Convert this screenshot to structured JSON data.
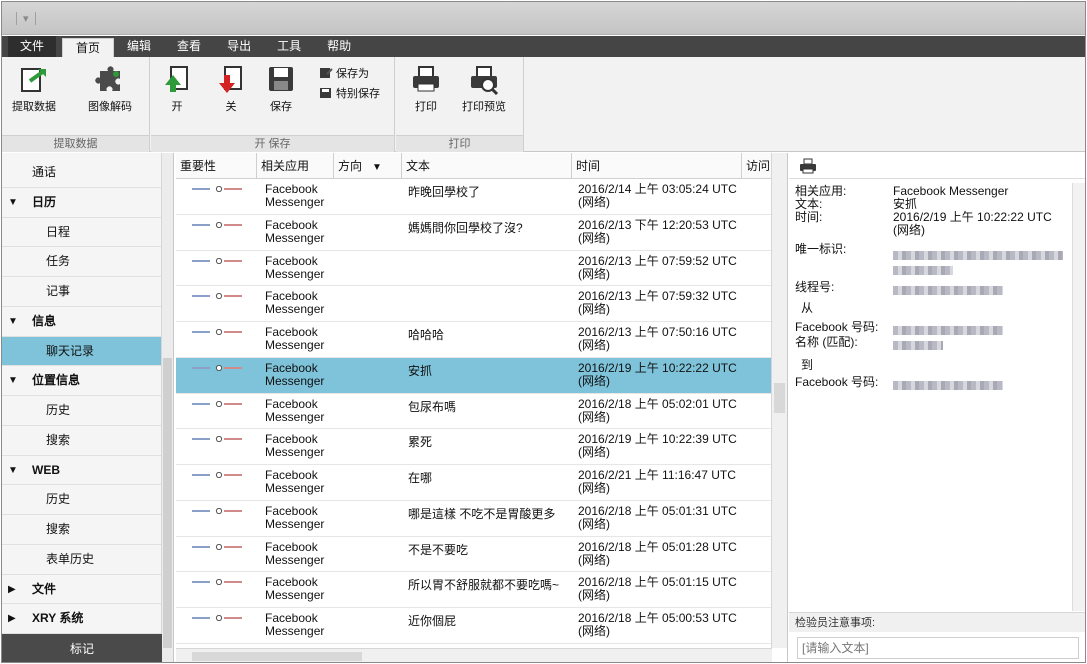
{
  "menubar": {
    "file": "文件",
    "tabs": [
      "首页",
      "编辑",
      "查看",
      "导出",
      "工具",
      "帮助"
    ]
  },
  "ribbon": {
    "groups": {
      "extract": "提取数据",
      "open_save": "开 保存",
      "print": "打印"
    },
    "buttons": {
      "extract_data": "提取数据",
      "image_decode": "图像解码",
      "open": "开",
      "close": "关",
      "save": "保存",
      "save_as": "保存为",
      "special_save": "特别保存",
      "print": "打印",
      "print_preview": "打印预览"
    }
  },
  "sidebar": {
    "items": [
      {
        "label": "通话",
        "level": 0,
        "arrow": ""
      },
      {
        "label": "日历",
        "level": 1,
        "arrow": "▼"
      },
      {
        "label": "日程",
        "level": 2,
        "arrow": ""
      },
      {
        "label": "任务",
        "level": 2,
        "arrow": ""
      },
      {
        "label": "记事",
        "level": 2,
        "arrow": ""
      },
      {
        "label": "信息",
        "level": 1,
        "arrow": "▼"
      },
      {
        "label": "聊天记录",
        "level": 2,
        "arrow": "",
        "selected": true
      },
      {
        "label": "位置信息",
        "level": 1,
        "arrow": "▼"
      },
      {
        "label": "历史",
        "level": 2,
        "arrow": ""
      },
      {
        "label": "搜索",
        "level": 2,
        "arrow": ""
      },
      {
        "label": "WEB",
        "level": 1,
        "arrow": "▼"
      },
      {
        "label": "历史",
        "level": 2,
        "arrow": ""
      },
      {
        "label": "搜索",
        "level": 2,
        "arrow": ""
      },
      {
        "label": "表单历史",
        "level": 2,
        "arrow": ""
      },
      {
        "label": "文件",
        "level": 1,
        "arrow": "▶"
      },
      {
        "label": "XRY 系统",
        "level": 1,
        "arrow": "▶"
      }
    ],
    "footer": "标记"
  },
  "table": {
    "columns": [
      "重要性",
      "相关应用",
      "方向",
      "文本",
      "时间",
      "访问"
    ],
    "rows": [
      {
        "app": "Facebook Messenger",
        "text": "昨晚回學校了",
        "time": "2016/2/14 上午 03:05:24 UTC (网络)"
      },
      {
        "app": "Facebook Messenger",
        "text": "媽媽問你回學校了沒?",
        "time": "2016/2/13 下午 12:20:53 UTC (网络)"
      },
      {
        "app": "Facebook Messenger",
        "text": "",
        "time": "2016/2/13 上午 07:59:52 UTC (网络)"
      },
      {
        "app": "Facebook Messenger",
        "text": "",
        "time": "2016/2/13 上午 07:59:32 UTC (网络)"
      },
      {
        "app": "Facebook Messenger",
        "text": "哈哈哈",
        "time": "2016/2/13 上午 07:50:16 UTC (网络)"
      },
      {
        "app": "Facebook Messenger",
        "text": "安抓",
        "time": "2016/2/19 上午 10:22:22 UTC (网络)",
        "selected": true
      },
      {
        "app": "Facebook Messenger",
        "text": "包尿布嗎",
        "time": "2016/2/18 上午 05:02:01 UTC (网络)"
      },
      {
        "app": "Facebook Messenger",
        "text": "累死",
        "time": "2016/2/19 上午 10:22:39 UTC (网络)"
      },
      {
        "app": "Facebook Messenger",
        "text": "在哪",
        "time": "2016/2/21 上午 11:16:47 UTC (网络)"
      },
      {
        "app": "Facebook Messenger",
        "text": "哪是這樣 不吃不是胃酸更多",
        "time": "2016/2/18 上午 05:01:31 UTC (网络)"
      },
      {
        "app": "Facebook Messenger",
        "text": "不是不要吃",
        "time": "2016/2/18 上午 05:01:28 UTC (网络)"
      },
      {
        "app": "Facebook Messenger",
        "text": "所以胃不舒服就都不要吃嗎~",
        "time": "2016/2/18 上午 05:01:15 UTC (网络)"
      },
      {
        "app": "Facebook Messenger",
        "text": "近你個屁",
        "time": "2016/2/18 上午 05:00:53 UTC (网络)"
      }
    ]
  },
  "detail": {
    "fields": {
      "app_label": "相关应用:",
      "app_value": "Facebook Messenger",
      "text_label": "文本:",
      "text_value": "安抓",
      "time_label": "时间:",
      "time_value": "2016/2/19 上午 10:22:22 UTC (网络)",
      "uid_label": "唯一标识:",
      "thread_label": "线程号:",
      "from_label": "从",
      "fb_id_label": "Facebook 号码:",
      "name_label": "名称 (匹配):",
      "to_label": "到",
      "fb_id_label2": "Facebook 号码:"
    },
    "notes_label": "检验员注意事项:",
    "notes_placeholder": "[请输入文本]"
  }
}
